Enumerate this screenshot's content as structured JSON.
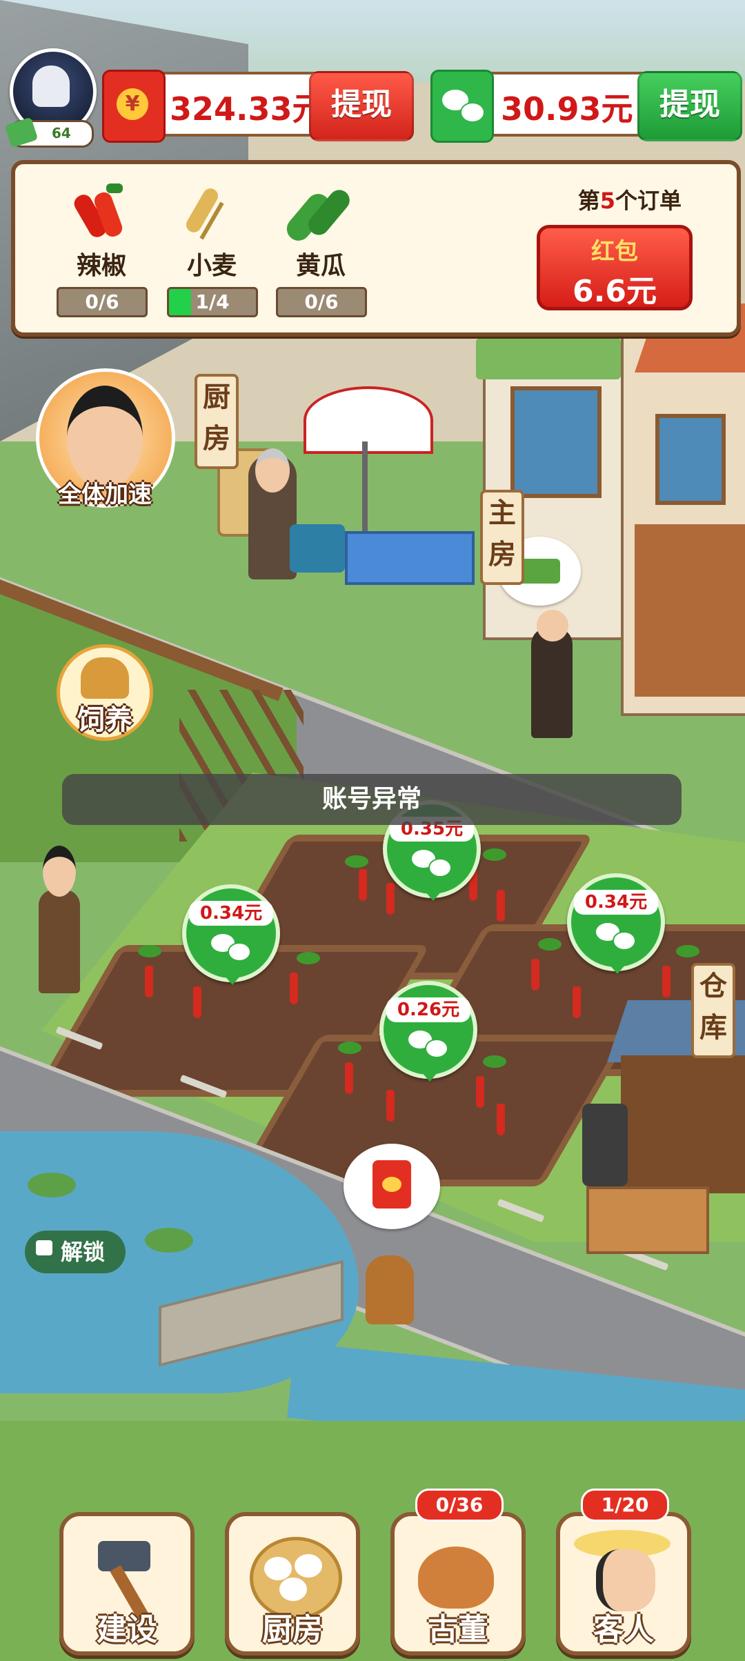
{
  "header": {
    "level": "64",
    "balance_cash": "324.33元",
    "balance_wechat": "30.93元",
    "withdraw_label": "提现"
  },
  "order": {
    "crops": [
      {
        "name": "辣椒",
        "progress_text": "0/6",
        "progress": 0.0
      },
      {
        "name": "小麦",
        "progress_text": "1/4",
        "progress": 0.25
      },
      {
        "name": "黄瓜",
        "progress_text": "0/6",
        "progress": 0.0
      }
    ],
    "order_prefix": "第",
    "order_number": "5",
    "order_suffix": "个订单",
    "reward_label": "红包",
    "reward_value": "6.6元"
  },
  "scene": {
    "speedup_label": "全体加速",
    "kitchen_sign": "厨房",
    "main_house_sign": "主房",
    "warehouse_sign": "仓库",
    "feed_label": "饲养",
    "toast": "账号异常",
    "unlock_label": "解锁",
    "plot_rewards": [
      "0.35元",
      "0.34元",
      "0.34元",
      "0.26元"
    ]
  },
  "bottom_nav": [
    {
      "label": "建设",
      "icon": "hammer-icon"
    },
    {
      "label": "厨房",
      "icon": "dumpling-basket-icon"
    },
    {
      "label": "古董",
      "icon": "teapot-icon",
      "count": "0/36"
    },
    {
      "label": "客人",
      "icon": "guest-woman-icon",
      "count": "1/20"
    }
  ],
  "colors": {
    "red": "#d01818",
    "wechat_green": "#2fae3e",
    "wood": "#8a5a32"
  }
}
